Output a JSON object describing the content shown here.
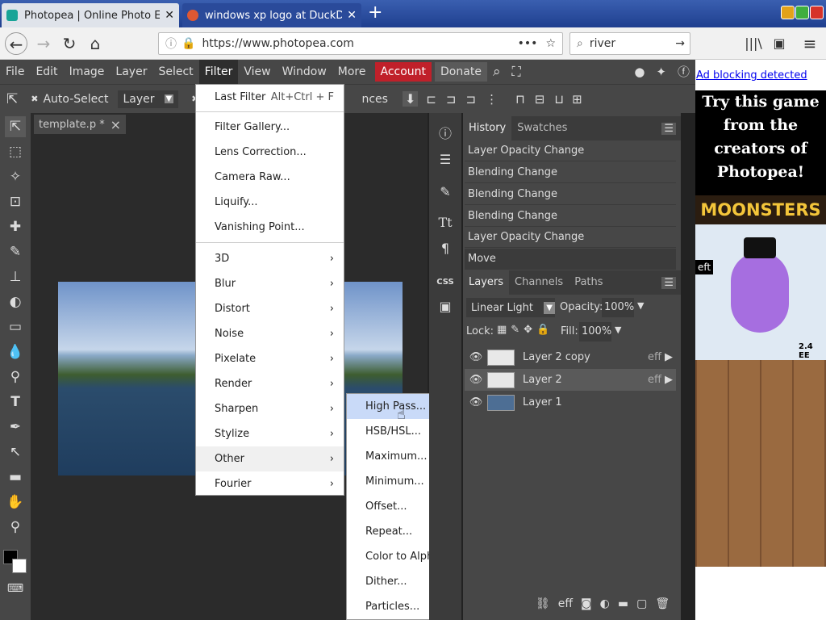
{
  "browser": {
    "tabs": [
      {
        "title": "Photopea | Online Photo Edit",
        "active": true
      },
      {
        "title": "windows xp logo at DuckDuc",
        "active": false
      }
    ],
    "new_tab": "+",
    "url": "https://www.photopea.com",
    "search_value": "river",
    "url_dots": "•••",
    "back_icon": "←",
    "forward_icon": "→",
    "reload_icon": "↻",
    "home_icon": "⌂",
    "menu_icon": "≡"
  },
  "menubar": {
    "items": [
      "File",
      "Edit",
      "Image",
      "Layer",
      "Select",
      "Filter",
      "View",
      "Window",
      "More"
    ],
    "account": "Account",
    "donate": "Donate"
  },
  "options": {
    "auto_select": "Auto-Select",
    "layer_select": "Layer",
    "partial_text": "nces"
  },
  "doc": {
    "tab_title": "template.p *",
    "close": "×"
  },
  "filter_menu": {
    "last_filter": "Last Filter",
    "last_filter_shortcut": "Alt+Ctrl + F",
    "group1": [
      "Filter Gallery...",
      "Lens Correction...",
      "Camera Raw...",
      "Liquify...",
      "Vanishing Point..."
    ],
    "group2": [
      "3D",
      "Blur",
      "Distort",
      "Noise",
      "Pixelate",
      "Render",
      "Sharpen",
      "Stylize",
      "Other",
      "Fourier"
    ]
  },
  "submenu": {
    "items": [
      "High Pass...",
      "HSB/HSL...",
      "Maximum...",
      "Minimum...",
      "Offset...",
      "Repeat...",
      "Color to Alpha...",
      "Dither...",
      "Particles..."
    ],
    "highlighted": "High Pass..."
  },
  "history": {
    "tabs": [
      "History",
      "Swatches"
    ],
    "entries": [
      "Layer Opacity Change",
      "Blending Change",
      "Blending Change",
      "Blending Change",
      "Layer Opacity Change",
      "Move"
    ]
  },
  "layers": {
    "tabs": [
      "Layers",
      "Channels",
      "Paths"
    ],
    "blend_mode": "Linear Light",
    "opacity_label": "Opacity:",
    "opacity_value": "100%",
    "lock_label": "Lock:",
    "fill_label": "Fill:",
    "fill_value": "100%",
    "items": [
      {
        "name": "Layer 2 copy",
        "eff": "eff"
      },
      {
        "name": "Layer 2",
        "eff": "eff"
      },
      {
        "name": "Layer 1",
        "eff": ""
      }
    ],
    "footer_eff": "eff"
  },
  "ad": {
    "blocking": "Ad blocking detected",
    "text": "Try this game from the creators of Photopea!",
    "game_title": "MOONSTERS",
    "partial_left": "eft",
    "partial_right": "2.4 EE"
  },
  "colors": {
    "panel": "#474747",
    "dark": "#2b2b2b",
    "account": "#c0202a",
    "highlight": "#c9daf8"
  }
}
